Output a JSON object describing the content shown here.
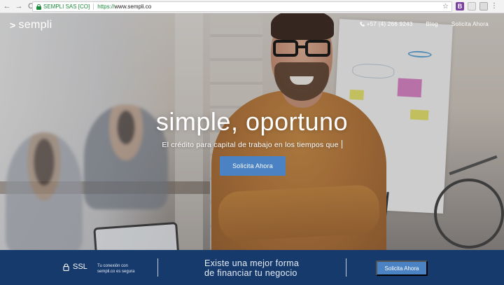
{
  "browser": {
    "nav": {
      "back": "←",
      "forward": "→",
      "reload": "C"
    },
    "ev_label": "SEMPLI SAS [CO]",
    "url_protocol": "https://",
    "url_host": "www.sempli.co",
    "star": "☆",
    "ext1": "B",
    "menu": "⋮"
  },
  "header": {
    "logo_chevron": ">",
    "logo_text": "sempli",
    "phone": "+57 (4) 266 9243",
    "blog": "Blog",
    "cta": "Solicita Ahora"
  },
  "hero": {
    "title": "simple, oportuno",
    "subtitle": "El crédito para capital de trabajo en los tiempos que",
    "cta": "Solicita Ahora"
  },
  "footer_bar": {
    "ssl_label": "SSL",
    "ssl_note_line1": "Tu conexión con",
    "ssl_note_line2": "sempli.co es segura",
    "tagline_line1": "Existe una mejor forma",
    "tagline_line2": "de financiar tu negocio",
    "cta": "Solicita Ahora"
  },
  "colors": {
    "accent_button": "#4a82c3",
    "bar_background": "#173a6d",
    "secure_green": "#1b8a3a"
  }
}
